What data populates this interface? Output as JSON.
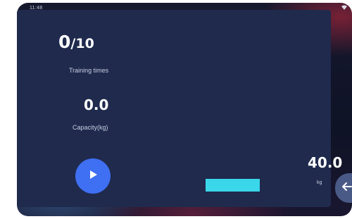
{
  "status_bar": {
    "time": "11:48",
    "icons": [
      "wifi-icon"
    ]
  },
  "training": {
    "count": "0",
    "total": "/10",
    "label": "Training times"
  },
  "capacity": {
    "value": "0.0",
    "label": "Capacity(kg)"
  },
  "weight": {
    "value": "40.0",
    "unit": "kg"
  },
  "colors": {
    "panel": "#1f2a4d",
    "play_button": "#3f6ff2",
    "indicator_bar": "#3ad7ea"
  }
}
